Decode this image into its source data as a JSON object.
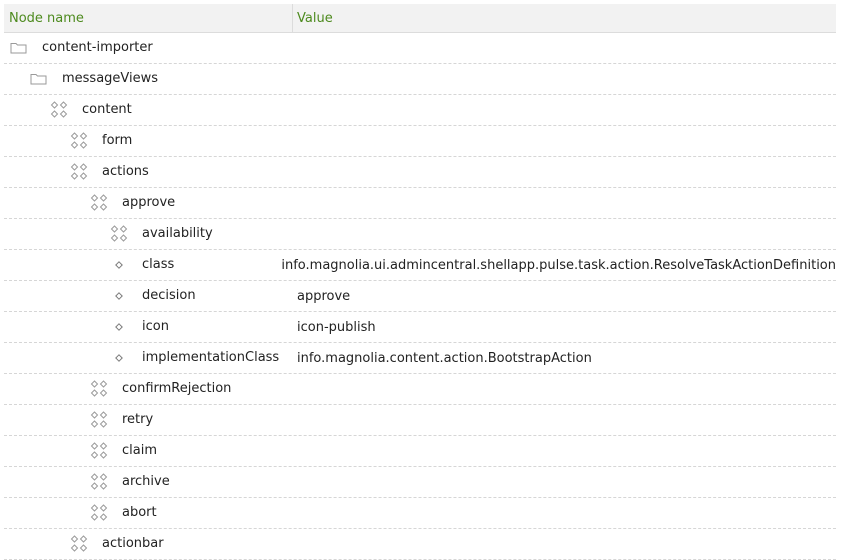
{
  "columns": {
    "name": "Node name",
    "value": "Value"
  },
  "rows": [
    {
      "name": "content-importer",
      "value": "",
      "icon": "folder-icon",
      "level": 0
    },
    {
      "name": "messageViews",
      "value": "",
      "icon": "folder-icon",
      "level": 1
    },
    {
      "name": "content",
      "value": "",
      "icon": "content-node-icon",
      "level": 2
    },
    {
      "name": "form",
      "value": "",
      "icon": "content-node-icon",
      "level": 3
    },
    {
      "name": "actions",
      "value": "",
      "icon": "content-node-icon",
      "level": 3
    },
    {
      "name": "approve",
      "value": "",
      "icon": "content-node-icon",
      "level": 4
    },
    {
      "name": "availability",
      "value": "",
      "icon": "content-node-icon",
      "level": 5
    },
    {
      "name": "class",
      "value": "info.magnolia.ui.admincentral.shellapp.pulse.task.action.ResolveTaskActionDefinition",
      "icon": "property-icon",
      "level": 5
    },
    {
      "name": "decision",
      "value": "approve",
      "icon": "property-icon",
      "level": 5
    },
    {
      "name": "icon",
      "value": "icon-publish",
      "icon": "property-icon",
      "level": 5
    },
    {
      "name": "implementationClass",
      "value": "info.magnolia.content.action.BootstrapAction",
      "icon": "property-icon",
      "level": 5
    },
    {
      "name": "confirmRejection",
      "value": "",
      "icon": "content-node-icon",
      "level": 4
    },
    {
      "name": "retry",
      "value": "",
      "icon": "content-node-icon",
      "level": 4
    },
    {
      "name": "claim",
      "value": "",
      "icon": "content-node-icon",
      "level": 4
    },
    {
      "name": "archive",
      "value": "",
      "icon": "content-node-icon",
      "level": 4
    },
    {
      "name": "abort",
      "value": "",
      "icon": "content-node-icon",
      "level": 4
    },
    {
      "name": "actionbar",
      "value": "",
      "icon": "content-node-icon",
      "level": 3
    }
  ]
}
